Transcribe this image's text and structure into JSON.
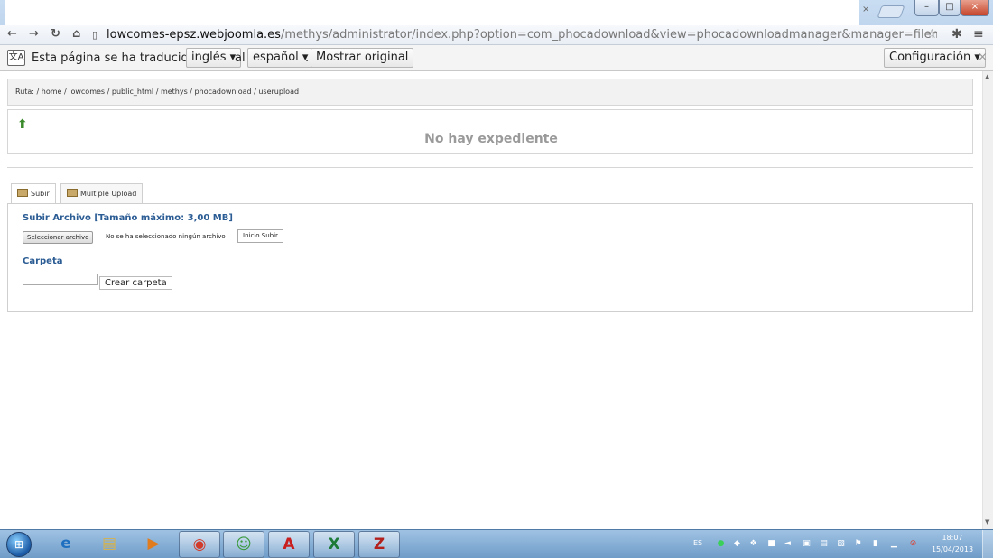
{
  "browser": {
    "url_host": "lowcomes-epsz.webjoomla.es",
    "url_rest": "/methys/administrator/index.php?option=com_phocadownload&view=phocadownloadmanager&manager=filemultiple&folder=component&folder",
    "window_controls": {
      "minimize": "–",
      "maximize": "□",
      "close": "×"
    },
    "tab_close": "×",
    "icons": [
      "back-icon",
      "forward-icon",
      "reload-icon",
      "home-icon",
      "star-icon",
      "extension-icon",
      "menu-icon"
    ]
  },
  "translate_bar": {
    "icon_text": "文A",
    "text_prefix": "Esta página se ha traducido del",
    "source_lang": "inglés ▾",
    "text_middle": "al",
    "target_lang": "español ▾",
    "text_dot": ".",
    "show_original": "Mostrar original",
    "settings": "Configuración ▾",
    "close": "×"
  },
  "page": {
    "path": "Ruta: / home / lowcomes / public_html / methys / phocadownload / userupload",
    "no_files": "No hay expediente",
    "tabs": [
      {
        "label": "Subir",
        "active": true
      },
      {
        "label": "Multiple Upload",
        "active": false
      }
    ],
    "upload_title": "Subir Archivo [Tamaño máximo: 3,00 MB]",
    "choose_file": "Seleccionar archivo",
    "no_file_selected": "No se ha seleccionado ningún archivo",
    "start_upload": "Inicio Subir",
    "folder_title": "Carpeta",
    "folder_input_value": "",
    "create_folder": "Crear carpeta",
    "title_color": "#2b5c94"
  },
  "taskbar": {
    "apps": [
      {
        "name": "internet-explorer",
        "glyph": "e",
        "open": false
      },
      {
        "name": "file-explorer",
        "glyph": "▤",
        "open": false
      },
      {
        "name": "media-player",
        "glyph": "▶",
        "open": false
      },
      {
        "name": "chrome",
        "glyph": "◉",
        "open": true
      },
      {
        "name": "messenger",
        "glyph": "☺",
        "open": true
      },
      {
        "name": "adobe-reader",
        "glyph": "A",
        "open": true
      },
      {
        "name": "excel",
        "glyph": "X",
        "open": true
      },
      {
        "name": "filezilla",
        "glyph": "Z",
        "open": true
      }
    ],
    "lang": "ES",
    "time": "18:07",
    "date": "15/04/2013"
  }
}
